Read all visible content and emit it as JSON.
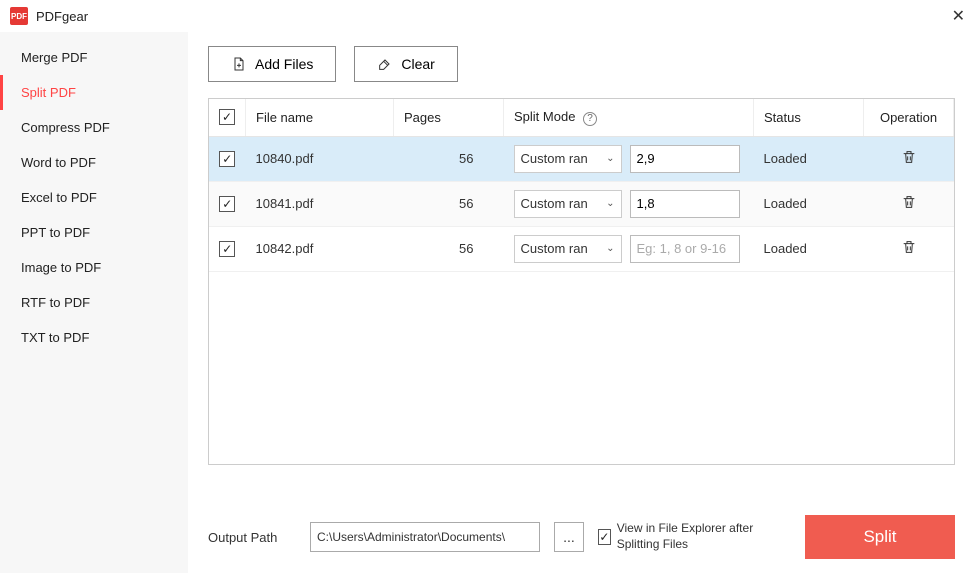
{
  "titlebar": {
    "app_name": "PDFgear"
  },
  "sidebar": {
    "items": [
      {
        "label": "Merge PDF",
        "active": false
      },
      {
        "label": "Split PDF",
        "active": true
      },
      {
        "label": "Compress PDF",
        "active": false
      },
      {
        "label": "Word to PDF",
        "active": false
      },
      {
        "label": "Excel to PDF",
        "active": false
      },
      {
        "label": "PPT to PDF",
        "active": false
      },
      {
        "label": "Image to PDF",
        "active": false
      },
      {
        "label": "RTF to PDF",
        "active": false
      },
      {
        "label": "TXT to PDF",
        "active": false
      }
    ]
  },
  "toolbar": {
    "add_files_label": "Add Files",
    "clear_label": "Clear"
  },
  "table": {
    "headers": {
      "filename": "File name",
      "pages": "Pages",
      "splitmode": "Split Mode",
      "status": "Status",
      "operation": "Operation"
    },
    "range_placeholder": "Eg: 1, 8 or 9-16",
    "rows": [
      {
        "checked": true,
        "filename": "10840.pdf",
        "pages": "56",
        "mode": "Custom ran",
        "range": "2,9",
        "status": "Loaded",
        "selected": true
      },
      {
        "checked": true,
        "filename": "10841.pdf",
        "pages": "56",
        "mode": "Custom ran",
        "range": "1,8",
        "status": "Loaded",
        "selected": false
      },
      {
        "checked": true,
        "filename": "10842.pdf",
        "pages": "56",
        "mode": "Custom ran",
        "range": "",
        "status": "Loaded",
        "selected": false
      }
    ]
  },
  "footer": {
    "output_path_label": "Output Path",
    "output_path": "C:\\Users\\Administrator\\Documents\\",
    "browse_label": "...",
    "view_in_explorer_label": "View in File Explorer after Splitting Files",
    "view_in_explorer_checked": true,
    "split_button": "Split"
  }
}
